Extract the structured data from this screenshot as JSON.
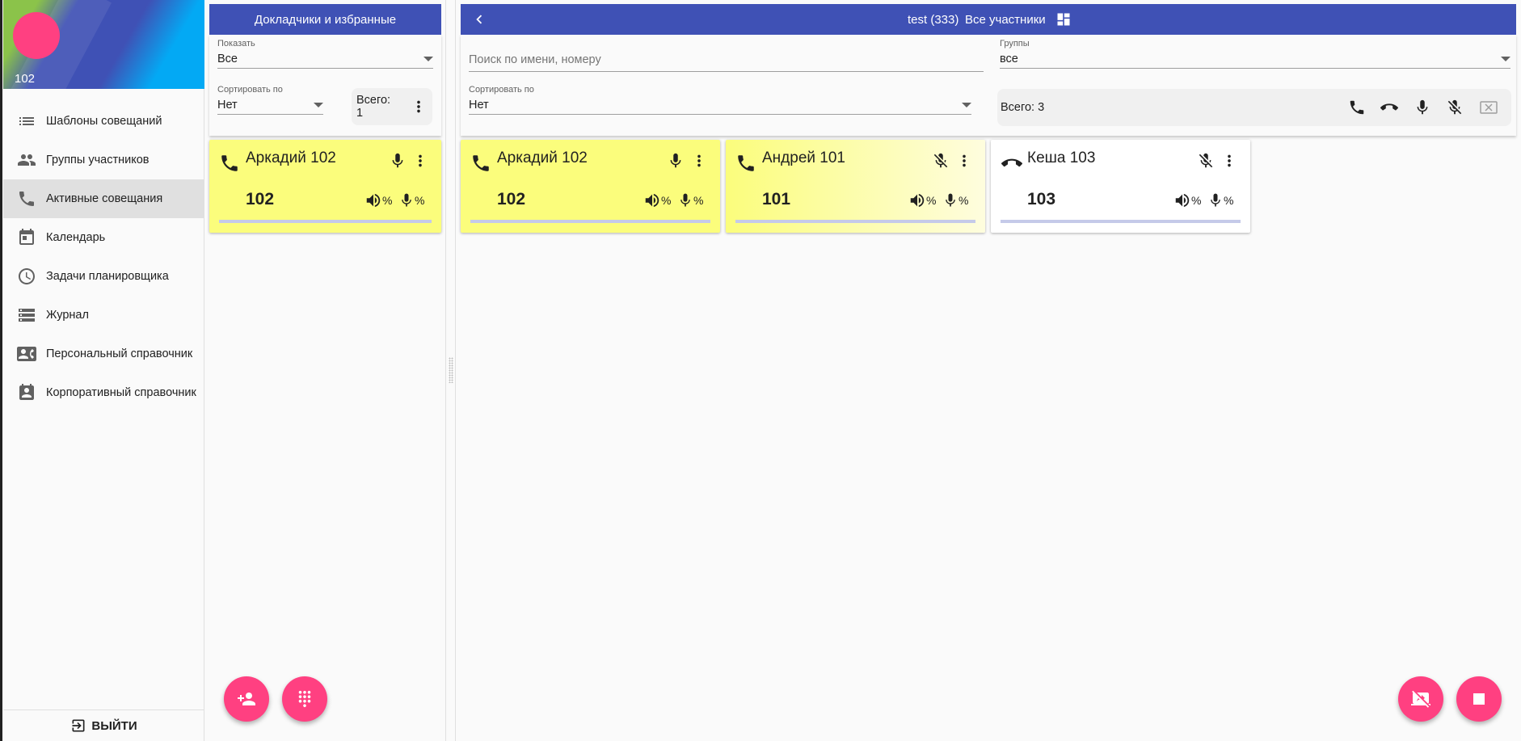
{
  "sidebar": {
    "user_number": "102",
    "items": [
      {
        "label": "Шаблоны совещаний",
        "icon": "list-icon"
      },
      {
        "label": "Группы участников",
        "icon": "people-icon"
      },
      {
        "label": "Активные совещания",
        "icon": "phone-icon",
        "active": true
      },
      {
        "label": "Календарь",
        "icon": "calendar-icon"
      },
      {
        "label": "Задачи планировщика",
        "icon": "clock-icon"
      },
      {
        "label": "Журнал",
        "icon": "storage-list-icon"
      },
      {
        "label": "Персональный справочник",
        "icon": "contact-card-icon"
      },
      {
        "label": "Корпоративный справочник",
        "icon": "contact-badge-icon"
      }
    ],
    "logout_label": "ВЫЙТИ"
  },
  "speakers_panel": {
    "title": "Докладчики и избранные",
    "show_label": "Показать",
    "show_value": "Все",
    "sort_label": "Сортировать по",
    "sort_value": "Нет",
    "total": "Всего: 1",
    "cards": [
      {
        "name": "Аркадий 102",
        "number": "102",
        "vol_pct": "%",
        "mic_pct": "%"
      }
    ]
  },
  "conference": {
    "title": "test (333)",
    "subtitle": "Все участники",
    "search_placeholder": "Поиск по имени, номеру",
    "groups_label": "Группы",
    "groups_value": "все",
    "sort_label": "Сортировать по",
    "sort_value": "Нет",
    "total": "Всего: 3",
    "participants": [
      {
        "name": "Аркадий 102",
        "number": "102",
        "status": "connected",
        "mic": "on",
        "vol_pct": "%",
        "mic_pct": "%"
      },
      {
        "name": "Андрей 101",
        "number": "101",
        "status": "connected",
        "mic": "off",
        "vol_pct": "%",
        "mic_pct": "%"
      },
      {
        "name": "Кеша 103",
        "number": "103",
        "status": "disconnected",
        "mic": "off",
        "vol_pct": "%",
        "mic_pct": "%"
      }
    ]
  },
  "colors": {
    "primary": "#3f51b5",
    "accent": "#ff4081",
    "speaking": "#fbfd7c"
  }
}
